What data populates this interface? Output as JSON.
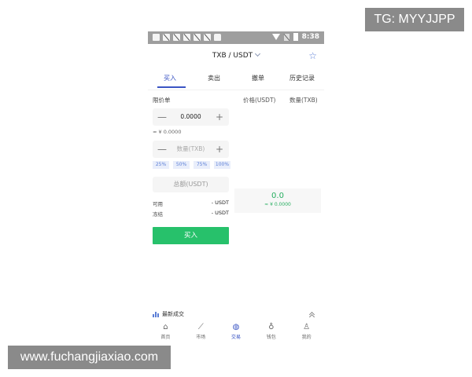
{
  "watermarks": {
    "top": "TG: MYYJJPP",
    "bottom": "www.fuchangjiaxiao.com"
  },
  "status_bar": {
    "time": "8:38",
    "icons": [
      "app-icon",
      "muted-icon",
      "muted-icon",
      "muted-icon",
      "muted-icon",
      "muted-icon",
      "bag-icon",
      "wifi-icon",
      "sim-off-icon",
      "battery-icon"
    ]
  },
  "header": {
    "pair": "TXB / USDT",
    "favorite_icon": "star-icon",
    "dropdown_icon": "chevron-down-icon"
  },
  "tabs": [
    {
      "label": "买入",
      "active": true
    },
    {
      "label": "卖出",
      "active": false
    },
    {
      "label": "撤单",
      "active": false
    },
    {
      "label": "历史记录",
      "active": false
    }
  ],
  "order_form": {
    "order_type": "限价单",
    "price": {
      "value": "0.0000",
      "minus": "—",
      "plus": "+"
    },
    "price_equiv": "≈ ¥ 0.0000",
    "quantity": {
      "placeholder": "数量(TXB)",
      "minus": "—",
      "plus": "+"
    },
    "percentages": [
      "25%",
      "50%",
      "75%",
      "100%"
    ],
    "total_placeholder": "总额(USDT)",
    "available": {
      "label": "可用",
      "value": "- USDT"
    },
    "frozen": {
      "label": "冻结",
      "value": "- USDT"
    },
    "submit_label": "买入"
  },
  "order_book": {
    "columns": [
      "价格(USDT)",
      "数量(TXB)"
    ],
    "last_price": "0.0",
    "last_price_cny": "≈ ¥ 0.0000"
  },
  "latest_trades": {
    "label": "最新成交"
  },
  "bottom_nav": [
    {
      "label": "首页",
      "icon": "home-icon",
      "active": false
    },
    {
      "label": "市场",
      "icon": "chart-icon",
      "active": false
    },
    {
      "label": "交易",
      "icon": "trade-icon",
      "active": true
    },
    {
      "label": "钱包",
      "icon": "wallet-icon",
      "active": false
    },
    {
      "label": "我的",
      "icon": "profile-icon",
      "active": false
    }
  ],
  "colors": {
    "accent": "#3b55c4",
    "buy_green": "#27c16b",
    "price_green": "#27ae60",
    "status_bar": "#9e9e9e"
  }
}
